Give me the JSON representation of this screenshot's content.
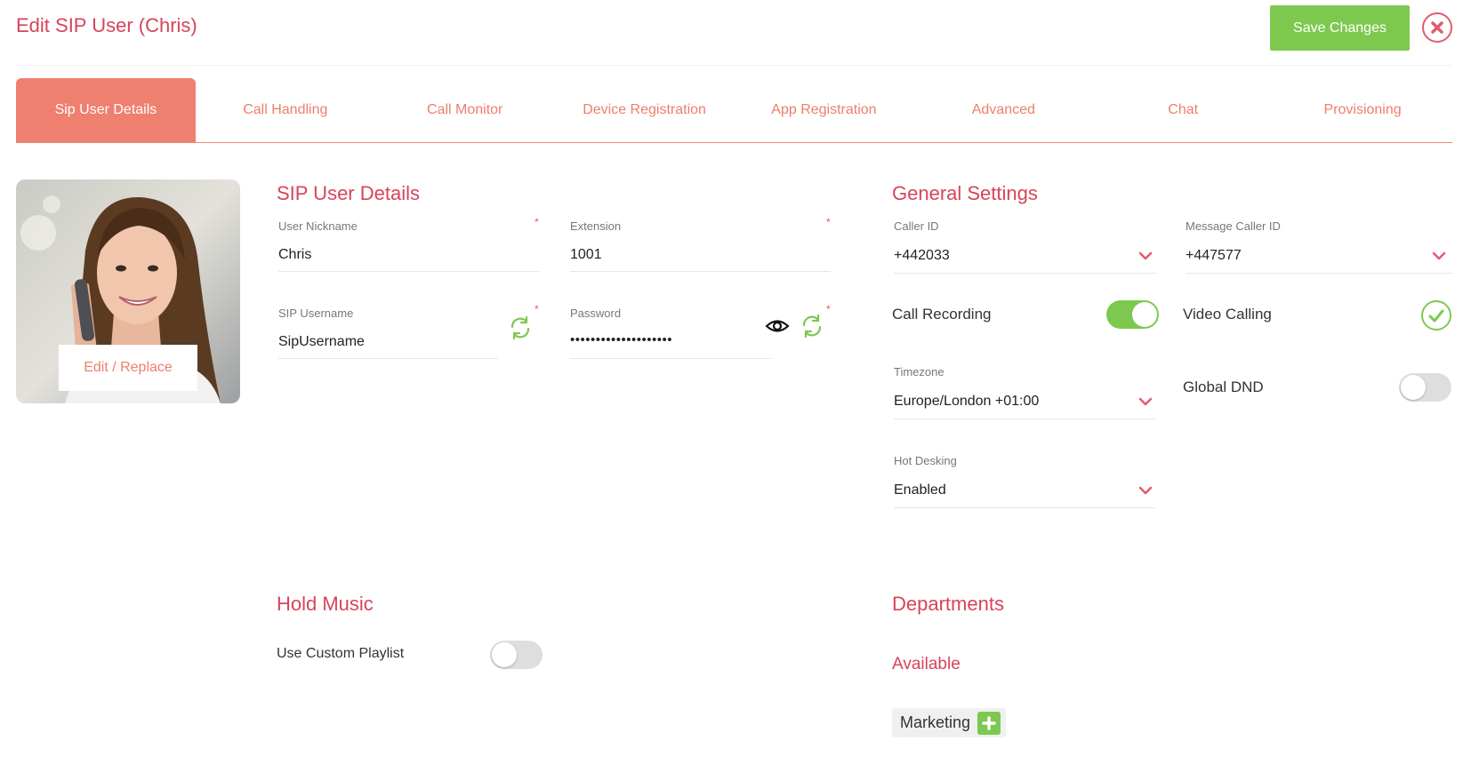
{
  "header": {
    "title": "Edit SIP User (Chris)",
    "save_label": "Save Changes"
  },
  "tabs": [
    {
      "label": "Sip User Details",
      "active": true
    },
    {
      "label": "Call Handling"
    },
    {
      "label": "Call Monitor"
    },
    {
      "label": "Device Registration"
    },
    {
      "label": "App Registration"
    },
    {
      "label": "Advanced"
    },
    {
      "label": "Chat"
    },
    {
      "label": "Provisioning"
    }
  ],
  "avatar": {
    "edit_label": "Edit / Replace"
  },
  "sip_details": {
    "title": "SIP User Details",
    "nickname_label": "User Nickname",
    "nickname_value": "Chris",
    "extension_label": "Extension",
    "extension_value": "1001",
    "sip_username_label": "SIP Username",
    "sip_username_value": "SipUsername",
    "password_label": "Password",
    "password_value": "••••••••••••••••••••",
    "required_mark": "*"
  },
  "general": {
    "title": "General Settings",
    "caller_id_label": "Caller ID",
    "caller_id_value": "+442033",
    "message_caller_id_label": "Message Caller ID",
    "message_caller_id_value": "+447577",
    "call_recording_label": "Call Recording",
    "call_recording_on": true,
    "video_calling_label": "Video Calling",
    "video_calling_on": true,
    "timezone_label": "Timezone",
    "timezone_value": "Europe/London +01:00",
    "global_dnd_label": "Global DND",
    "global_dnd_on": false,
    "hot_desking_label": "Hot Desking",
    "hot_desking_value": "Enabled"
  },
  "hold_music": {
    "title": "Hold Music",
    "custom_playlist_label": "Use Custom Playlist",
    "custom_playlist_on": false
  },
  "departments": {
    "title": "Departments",
    "available_label": "Available",
    "items": [
      "Marketing"
    ]
  },
  "colors": {
    "accent_red": "#d84458",
    "tab_salmon": "#ef7f6e",
    "green": "#7dc94f"
  }
}
